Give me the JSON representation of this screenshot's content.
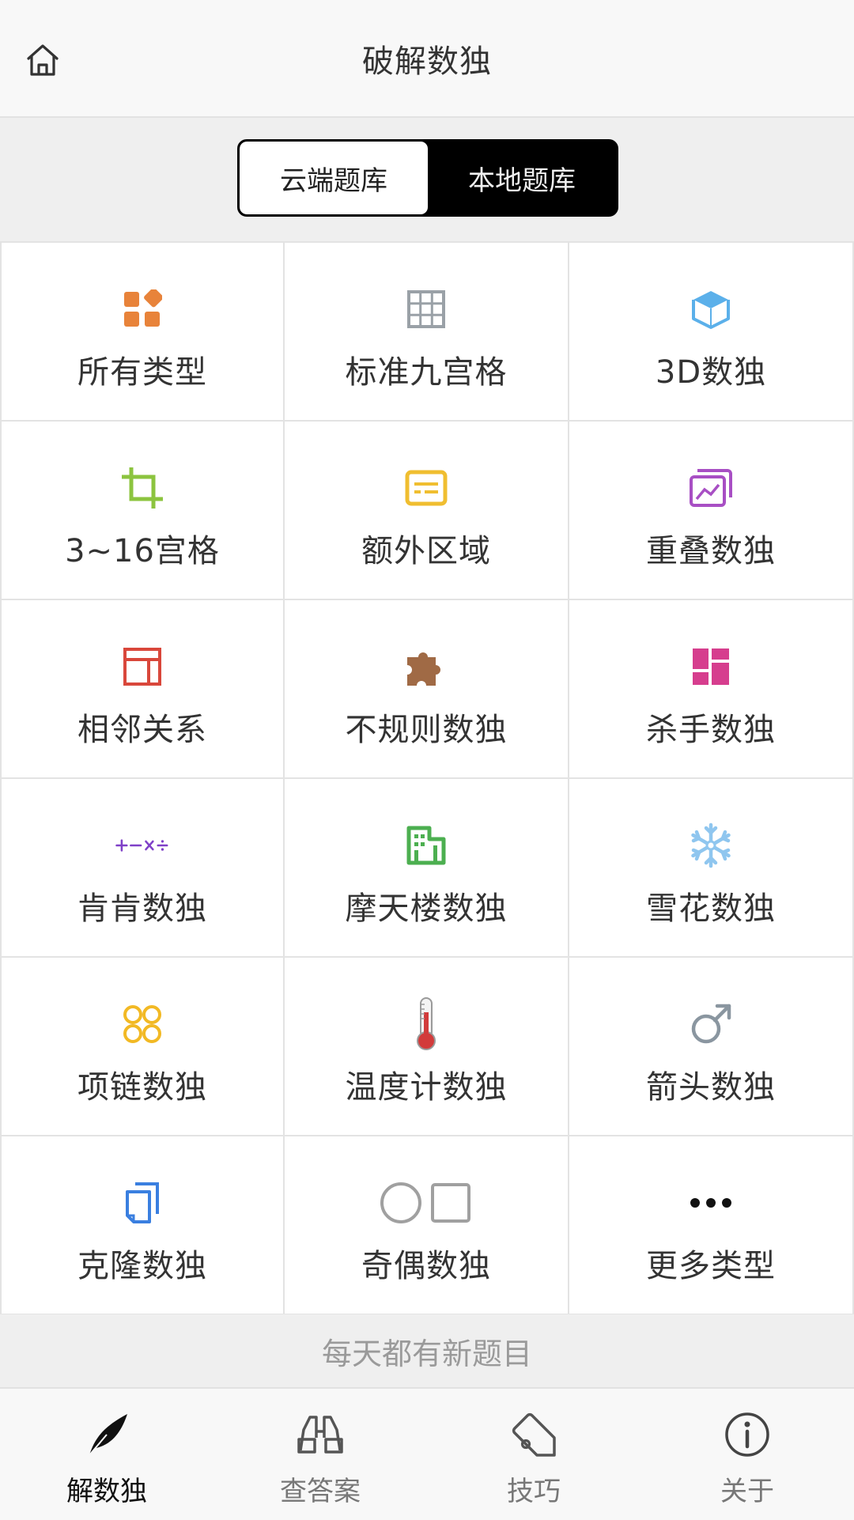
{
  "header": {
    "title": "破解数独",
    "home_icon": "home-icon"
  },
  "segment": {
    "left": "云端题库",
    "right": "本地题库",
    "selected": "云端题库"
  },
  "grid": [
    {
      "label": "所有类型",
      "icon": "apps-icon",
      "color": "#e8833a"
    },
    {
      "label": "标准九宫格",
      "icon": "grid-icon",
      "color": "#9aa1a7"
    },
    {
      "label": "3D数独",
      "icon": "cube-icon",
      "color": "#5bb0ea"
    },
    {
      "label": "3~16宫格",
      "icon": "crop-icon",
      "color": "#8cc43f"
    },
    {
      "label": "额外区域",
      "icon": "card-icon",
      "color": "#f0be30"
    },
    {
      "label": "重叠数独",
      "icon": "gallery-icon",
      "color": "#a84fc4"
    },
    {
      "label": "相邻关系",
      "icon": "layout-icon",
      "color": "#d9473b"
    },
    {
      "label": "不规则数独",
      "icon": "puzzle-icon",
      "color": "#a06a45"
    },
    {
      "label": "杀手数独",
      "icon": "dashboard-icon",
      "color": "#d63e8e"
    },
    {
      "label": "肯肯数独",
      "icon": "math-icon",
      "color": "#7f40c8"
    },
    {
      "label": "摩天楼数独",
      "icon": "building-icon",
      "color": "#4caf50"
    },
    {
      "label": "雪花数独",
      "icon": "snowflake-icon",
      "color": "#8fc6ef"
    },
    {
      "label": "项链数独",
      "icon": "necklace-icon",
      "color": "#f2b924"
    },
    {
      "label": "温度计数独",
      "icon": "thermometer-icon",
      "color": "#d23b3b"
    },
    {
      "label": "箭头数独",
      "icon": "arrow-male-icon",
      "color": "#8a96a0"
    },
    {
      "label": "克隆数独",
      "icon": "clone-icon",
      "color": "#3a7fe0"
    },
    {
      "label": "奇偶数独",
      "icon": "circle-square-icon",
      "color": "#a0a0a0"
    },
    {
      "label": "更多类型",
      "icon": "more-icon",
      "color": "#111111"
    }
  ],
  "note": "每天都有新题目",
  "tabs": [
    {
      "label": "解数独",
      "icon": "feather-icon",
      "active": true
    },
    {
      "label": "查答案",
      "icon": "binoculars-icon",
      "active": false
    },
    {
      "label": "技巧",
      "icon": "tag-icon",
      "active": false
    },
    {
      "label": "关于",
      "icon": "info-icon",
      "active": false
    }
  ]
}
